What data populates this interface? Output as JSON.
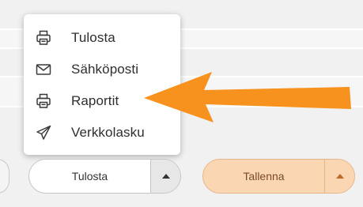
{
  "menu": {
    "items": [
      {
        "label": "Tulosta",
        "icon": "printer-icon"
      },
      {
        "label": "Sähköposti",
        "icon": "envelope-icon"
      },
      {
        "label": "Raportit",
        "icon": "printer-icon"
      },
      {
        "label": "Verkkolasku",
        "icon": "send-icon"
      }
    ]
  },
  "toolbar": {
    "print_label": "Tulosta",
    "save_label": "Tallenna"
  },
  "colors": {
    "annotation_arrow": "#f7921e",
    "save_button_bg": "#fbd6b3",
    "icon_stroke": "#3a3a3a"
  }
}
